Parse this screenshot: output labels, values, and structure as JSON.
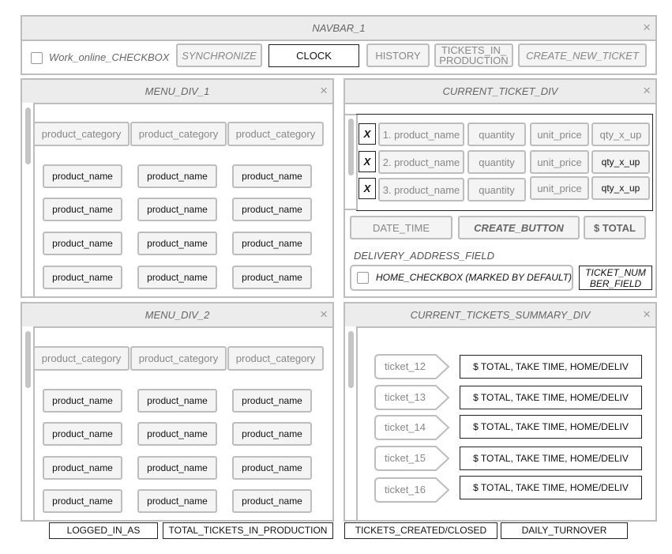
{
  "navbar": {
    "title": "NAVBAR_1",
    "close": "×",
    "work_online_label": "Work_online_CHECKBOX",
    "buttons": {
      "synchronize": "SYNCHRONIZE",
      "clock": "CLOCK",
      "history": "HISTORY",
      "tickets_in_production_1": "TICKETS_IN_",
      "tickets_in_production_2": "PRODUCTION",
      "create_new_ticket": "CREATE_NEW_TICKET"
    }
  },
  "menu1": {
    "title": "MENU_DIV_1",
    "close": "×",
    "categories": [
      "product_category",
      "product_category",
      "product_category"
    ],
    "products": [
      "product_name",
      "product_name",
      "product_name",
      "product_name",
      "product_name",
      "product_name",
      "product_name",
      "product_name",
      "product_name",
      "product_name",
      "product_name",
      "product_name"
    ]
  },
  "menu2": {
    "title": "MENU_DIV_2",
    "close": "×",
    "categories": [
      "product_category",
      "product_category",
      "product_category"
    ],
    "products": [
      "product_name",
      "product_name",
      "product_name",
      "product_name",
      "product_name",
      "product_name",
      "product_name",
      "product_name",
      "product_name",
      "product_name",
      "product_name",
      "product_name"
    ]
  },
  "current_ticket": {
    "title": "CURRENT_TICKET_DIV",
    "close": "×",
    "lines": [
      {
        "remove": "X",
        "product": "1. product_name",
        "quantity": "quantity",
        "unit_price": "unit_price",
        "total": "qty_x_up"
      },
      {
        "remove": "X",
        "product": "2. product_name",
        "quantity": "quantity",
        "unit_price": "unit_price",
        "total": "qty_x_up"
      },
      {
        "remove": "X",
        "product": "3. product_name",
        "quantity": "quantity",
        "unit_price": "unit_price",
        "total": "qty_x_up"
      }
    ],
    "date_time": "DATE_TIME",
    "create_button": "CREATE_BUTTON",
    "total": "$ TOTAL",
    "delivery_label": "DELIVERY_ADDRESS_FIELD",
    "home_checkbox_label": "HOME_CHECKBOX (MARKED BY DEFAULT)",
    "ticket_number_1": "TICKET_NUM",
    "ticket_number_2": "BER_FIELD"
  },
  "summary": {
    "title": "CURRENT_TICKETS_SUMMARY_DIV",
    "close": "×",
    "tickets": [
      {
        "name": "ticket_12",
        "info": "$ TOTAL, TAKE TIME, HOME/DELIV"
      },
      {
        "name": "ticket_13",
        "info": "$ TOTAL, TAKE TIME, HOME/DELIV"
      },
      {
        "name": "ticket_14",
        "info": "$ TOTAL, TAKE TIME, HOME/DELIV"
      },
      {
        "name": "ticket_15",
        "info": "$ TOTAL, TAKE TIME, HOME/DELIV"
      },
      {
        "name": "ticket_16",
        "info": "$ TOTAL, TAKE TIME, HOME/DELIV"
      }
    ]
  },
  "footer": {
    "logged_in_as": "LOGGED_IN_AS",
    "total_tickets_in_production": "TOTAL_TICKETS_IN_PRODUCTION",
    "tickets_created_closed": "TICKETS_CREATED/CLOSED",
    "daily_turnover": "DAILY_TURNOVER"
  },
  "icons": {
    "close": "close-icon",
    "checkbox": "checkbox-icon",
    "scrollbar": "scrollbar-thumb"
  }
}
